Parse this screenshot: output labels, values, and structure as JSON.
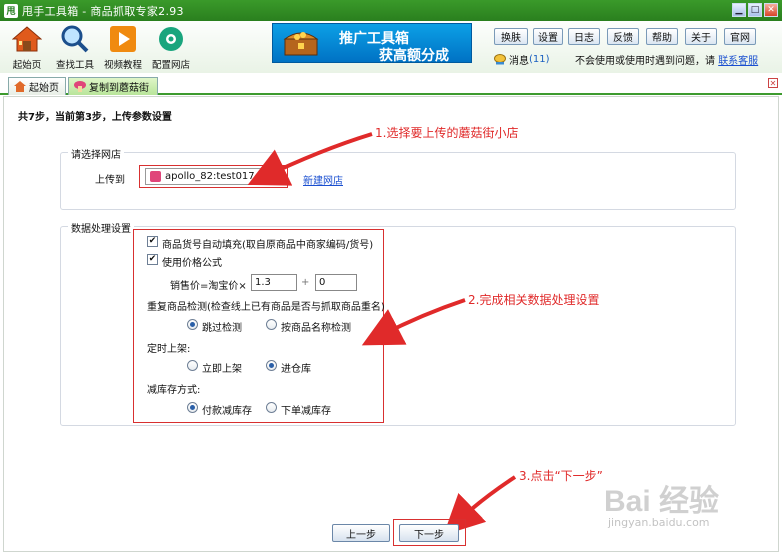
{
  "window": {
    "app_logo": "甩",
    "title": "甩手工具箱 - 商品抓取专家2.93"
  },
  "toolbar": {
    "tools": [
      {
        "label": "起始页",
        "icon": "home-icon"
      },
      {
        "label": "查找工具",
        "icon": "magnifier-icon"
      },
      {
        "label": "视频教程",
        "icon": "play-icon"
      },
      {
        "label": "配置网店",
        "icon": "gear-icon"
      }
    ],
    "banner": {
      "line1": "推广工具箱",
      "line2": "获高额分成"
    },
    "buttons": [
      "换肤",
      "设置",
      "日志",
      "反馈",
      "帮助",
      "关于",
      "官网"
    ],
    "message_label": "消息",
    "message_count": "(11)",
    "help_text": "不会使用或使用时遇到问题，请",
    "help_link": "联系客服"
  },
  "tabs": [
    {
      "label": "起始页",
      "icon": "home-icon",
      "active": false
    },
    {
      "label": "复制到蘑菇街",
      "icon": "mushroom-icon",
      "active": true
    }
  ],
  "wizard": {
    "step_text": "共7步，当前第3步，上传参数设置",
    "shop_group": {
      "title": "请选择网店",
      "upload_label": "上传到",
      "selected_shop": "apollo_82:test017",
      "new_shop_link": "新建网店"
    },
    "data_group": {
      "title": "数据处理设置",
      "auto_fill_label": "商品货号自动填充(取自原商品中商家编码/货号)",
      "auto_fill_checked": true,
      "price_formula_label": "使用价格公式",
      "price_formula_checked": true,
      "price_eq_label": "销售价=淘宝价×",
      "multiplier": "1.3",
      "plus_sign": "+",
      "addend": "0",
      "duplicate_label": "重复商品检测(检查线上已有商品是否与抓取商品重名)",
      "duplicate_options": [
        "跳过检测",
        "按商品名称检测"
      ],
      "duplicate_selected": "跳过检测",
      "schedule_label": "定时上架:",
      "schedule_options": [
        "立即上架",
        "进仓库"
      ],
      "schedule_selected": "进仓库",
      "stock_label": "减库存方式:",
      "stock_options": [
        "付款减库存",
        "下单减库存"
      ],
      "stock_selected": "付款减库存"
    },
    "prev_button": "上一步",
    "next_button": "下一步"
  },
  "annotations": {
    "a1": "1.选择要上传的蘑菇街小店",
    "a2": "2.完成相关数据处理设置",
    "a3": "3.点击“下一步”",
    "color": "#e02a2a"
  },
  "watermark": {
    "text": "Bai 经验",
    "url": "jingyan.baidu.com"
  }
}
